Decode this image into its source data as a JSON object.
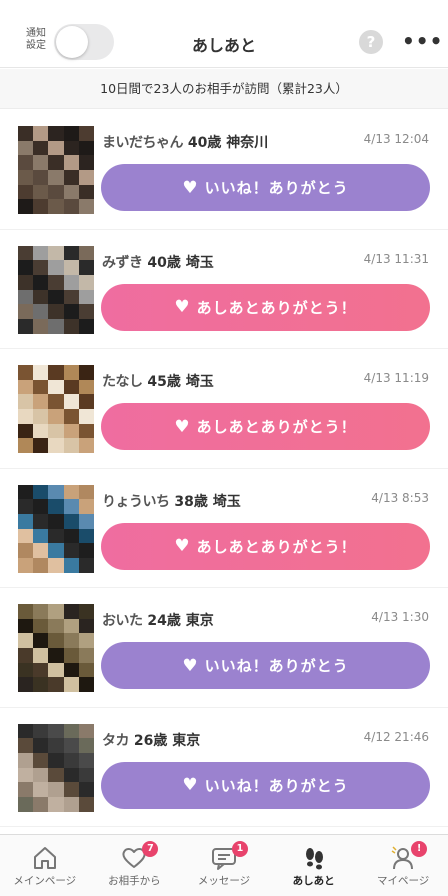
{
  "header": {
    "notification_label": "通知設定",
    "title": "あしあと",
    "help_glyph": "?",
    "more_glyph": "•••"
  },
  "summary": "10日間で23人のお相手が訪問（累計23人）",
  "colors": {
    "purple_button": "#9b82cf",
    "pink_button": "#ef6da0",
    "badge": "#e8436c"
  },
  "visitors": [
    {
      "nickname": "まいだちゃん",
      "age": "40歳",
      "area": "神奈川",
      "time": "4/13 12:04",
      "button": "いいね！ありがとう",
      "button_type": "purple"
    },
    {
      "nickname": "みずき",
      "age": "40歳",
      "area": "埼玉",
      "time": "4/13 11:31",
      "button": "あしあとありがとう！",
      "button_type": "pink"
    },
    {
      "nickname": "たなし",
      "age": "45歳",
      "area": "埼玉",
      "time": "4/13 11:19",
      "button": "あしあとありがとう！",
      "button_type": "pink"
    },
    {
      "nickname": "りょういち",
      "age": "38歳",
      "area": "埼玉",
      "time": "4/13 8:53",
      "button": "あしあとありがとう！",
      "button_type": "pink"
    },
    {
      "nickname": "おいた",
      "age": "24歳",
      "area": "東京",
      "time": "4/13 1:30",
      "button": "いいね！ありがとう",
      "button_type": "purple"
    },
    {
      "nickname": "タカ",
      "age": "26歳",
      "area": "東京",
      "time": "4/12 21:46",
      "button": "いいね！ありがとう",
      "button_type": "purple"
    }
  ],
  "tabs": [
    {
      "label": "メインページ",
      "icon": "home-icon",
      "badge": ""
    },
    {
      "label": "お相手から",
      "icon": "heart-icon",
      "badge": "7"
    },
    {
      "label": "メッセージ",
      "icon": "message-icon",
      "badge": "1"
    },
    {
      "label": "あしあと",
      "icon": "footprints-icon",
      "badge": "",
      "active": true
    },
    {
      "label": "マイページ",
      "icon": "person-icon",
      "badge": "!"
    }
  ]
}
